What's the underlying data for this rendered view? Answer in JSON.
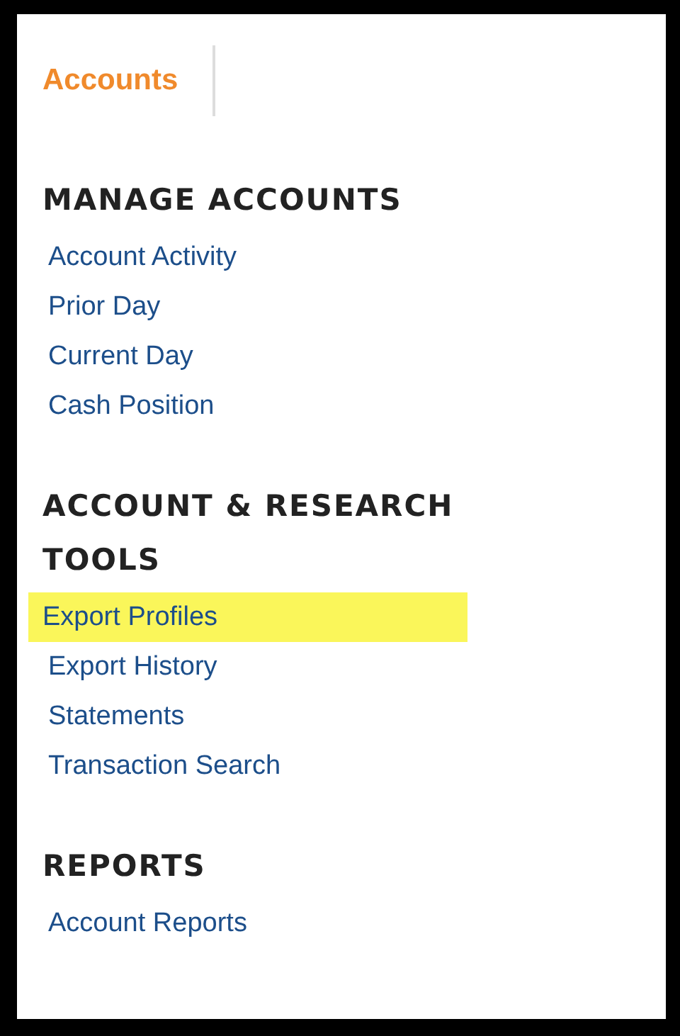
{
  "header": {
    "tab": "Accounts"
  },
  "sections": [
    {
      "heading": "MANAGE ACCOUNTS",
      "links": [
        {
          "label": "Account Activity",
          "selected": false
        },
        {
          "label": "Prior Day",
          "selected": false
        },
        {
          "label": "Current Day",
          "selected": false
        },
        {
          "label": "Cash Position",
          "selected": false
        }
      ]
    },
    {
      "heading": "ACCOUNT & RESEARCH TOOLS",
      "links": [
        {
          "label": "Export Profiles",
          "selected": true
        },
        {
          "label": "Export History",
          "selected": false
        },
        {
          "label": "Statements",
          "selected": false
        },
        {
          "label": "Transaction Search",
          "selected": false
        }
      ]
    },
    {
      "heading": "REPORTS",
      "links": [
        {
          "label": "Account Reports",
          "selected": false
        }
      ]
    }
  ]
}
